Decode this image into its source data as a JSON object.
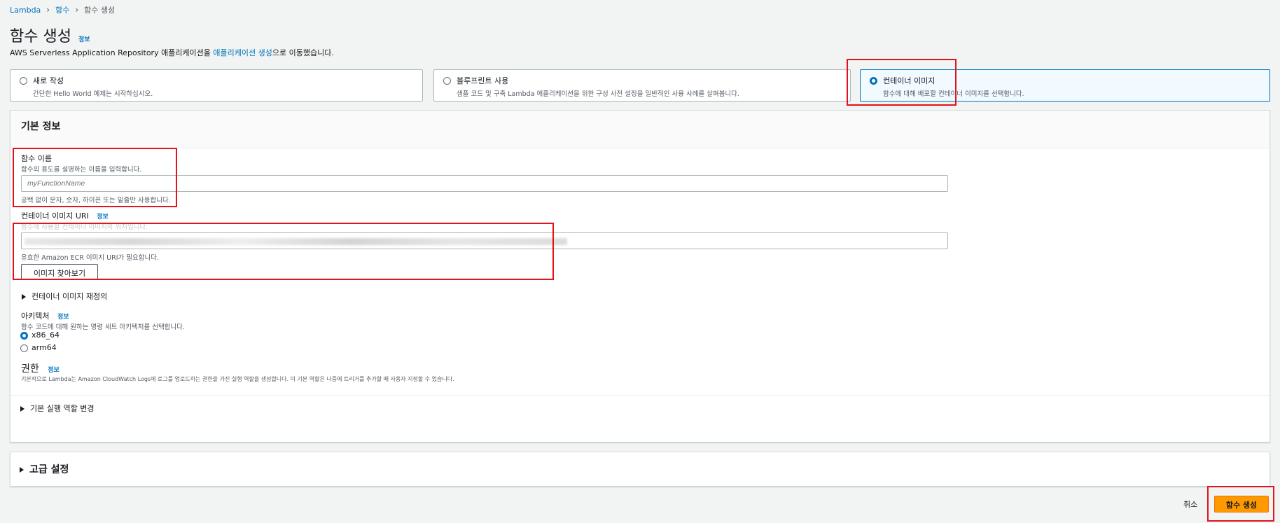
{
  "breadcrumb": {
    "root": "Lambda",
    "parent": "함수",
    "current": "함수 생성"
  },
  "page": {
    "title": "함수 생성",
    "info": "정보",
    "subtitle_prefix": "AWS Serverless Application Repository 애플리케이션을 ",
    "subtitle_link": "애플리케이션 생성",
    "subtitle_suffix": "으로 이동했습니다."
  },
  "options": [
    {
      "title": "새로 작성",
      "desc": "간단한 Hello World 예제는 시작하십시오.",
      "selected": false
    },
    {
      "title": "블루프린트 사용",
      "desc": "샘플 코드 및 구축 Lambda 애플리케이션을 위한 구성 사전 설정을 일반적인 사용 사례를 살펴봅니다.",
      "selected": false
    },
    {
      "title": "컨테이너 이미지",
      "desc": "함수에 대해 배포할 컨테이너 이미지를 선택합니다.",
      "selected": true
    }
  ],
  "basic": {
    "header": "기본 정보",
    "fn_name_label": "함수 이름",
    "fn_name_desc": "함수의 용도를 설명하는 이름을 입력합니다.",
    "fn_name_placeholder": "myFunctionName",
    "fn_name_hint": "공백 없이 문자, 숫자, 하이픈 또는 밑줄만 사용합니다.",
    "uri_label": "컨테이너 이미지 URI",
    "uri_info": "정보",
    "uri_desc": "함수에 사용할 컨테이너 이미지의 위치입니다.",
    "uri_hint": "유효한 Amazon ECR 이미지 URI가 필요합니다.",
    "browse_button": "이미지 찾아보기",
    "override_toggle": "컨테이너 이미지 재정의",
    "arch_label": "아키텍처",
    "arch_info": "정보",
    "arch_desc": "함수 코드에 대해 원하는 명령 세트 아키텍처를 선택합니다.",
    "arch_options": [
      {
        "label": "x86_64",
        "selected": true
      },
      {
        "label": "arm64",
        "selected": false
      }
    ],
    "perm_label": "권한",
    "perm_info": "정보",
    "perm_desc": "기본적으로 Lambda는 Amazon CloudWatch Logs에 로그를 업로드하는 권한을 가진 실행 역할을 생성합니다. 이 기본 역할은 나중에 트리거를 추가할 때 사용자 지정할 수 있습니다.",
    "role_toggle": "기본 실행 역할 변경"
  },
  "advanced": {
    "label": "고급 설정"
  },
  "footer": {
    "cancel": "취소",
    "create": "함수 생성"
  },
  "colors": {
    "accent": "#0073bb",
    "primary_button": "#ff9900",
    "highlight": "#e3131b"
  }
}
